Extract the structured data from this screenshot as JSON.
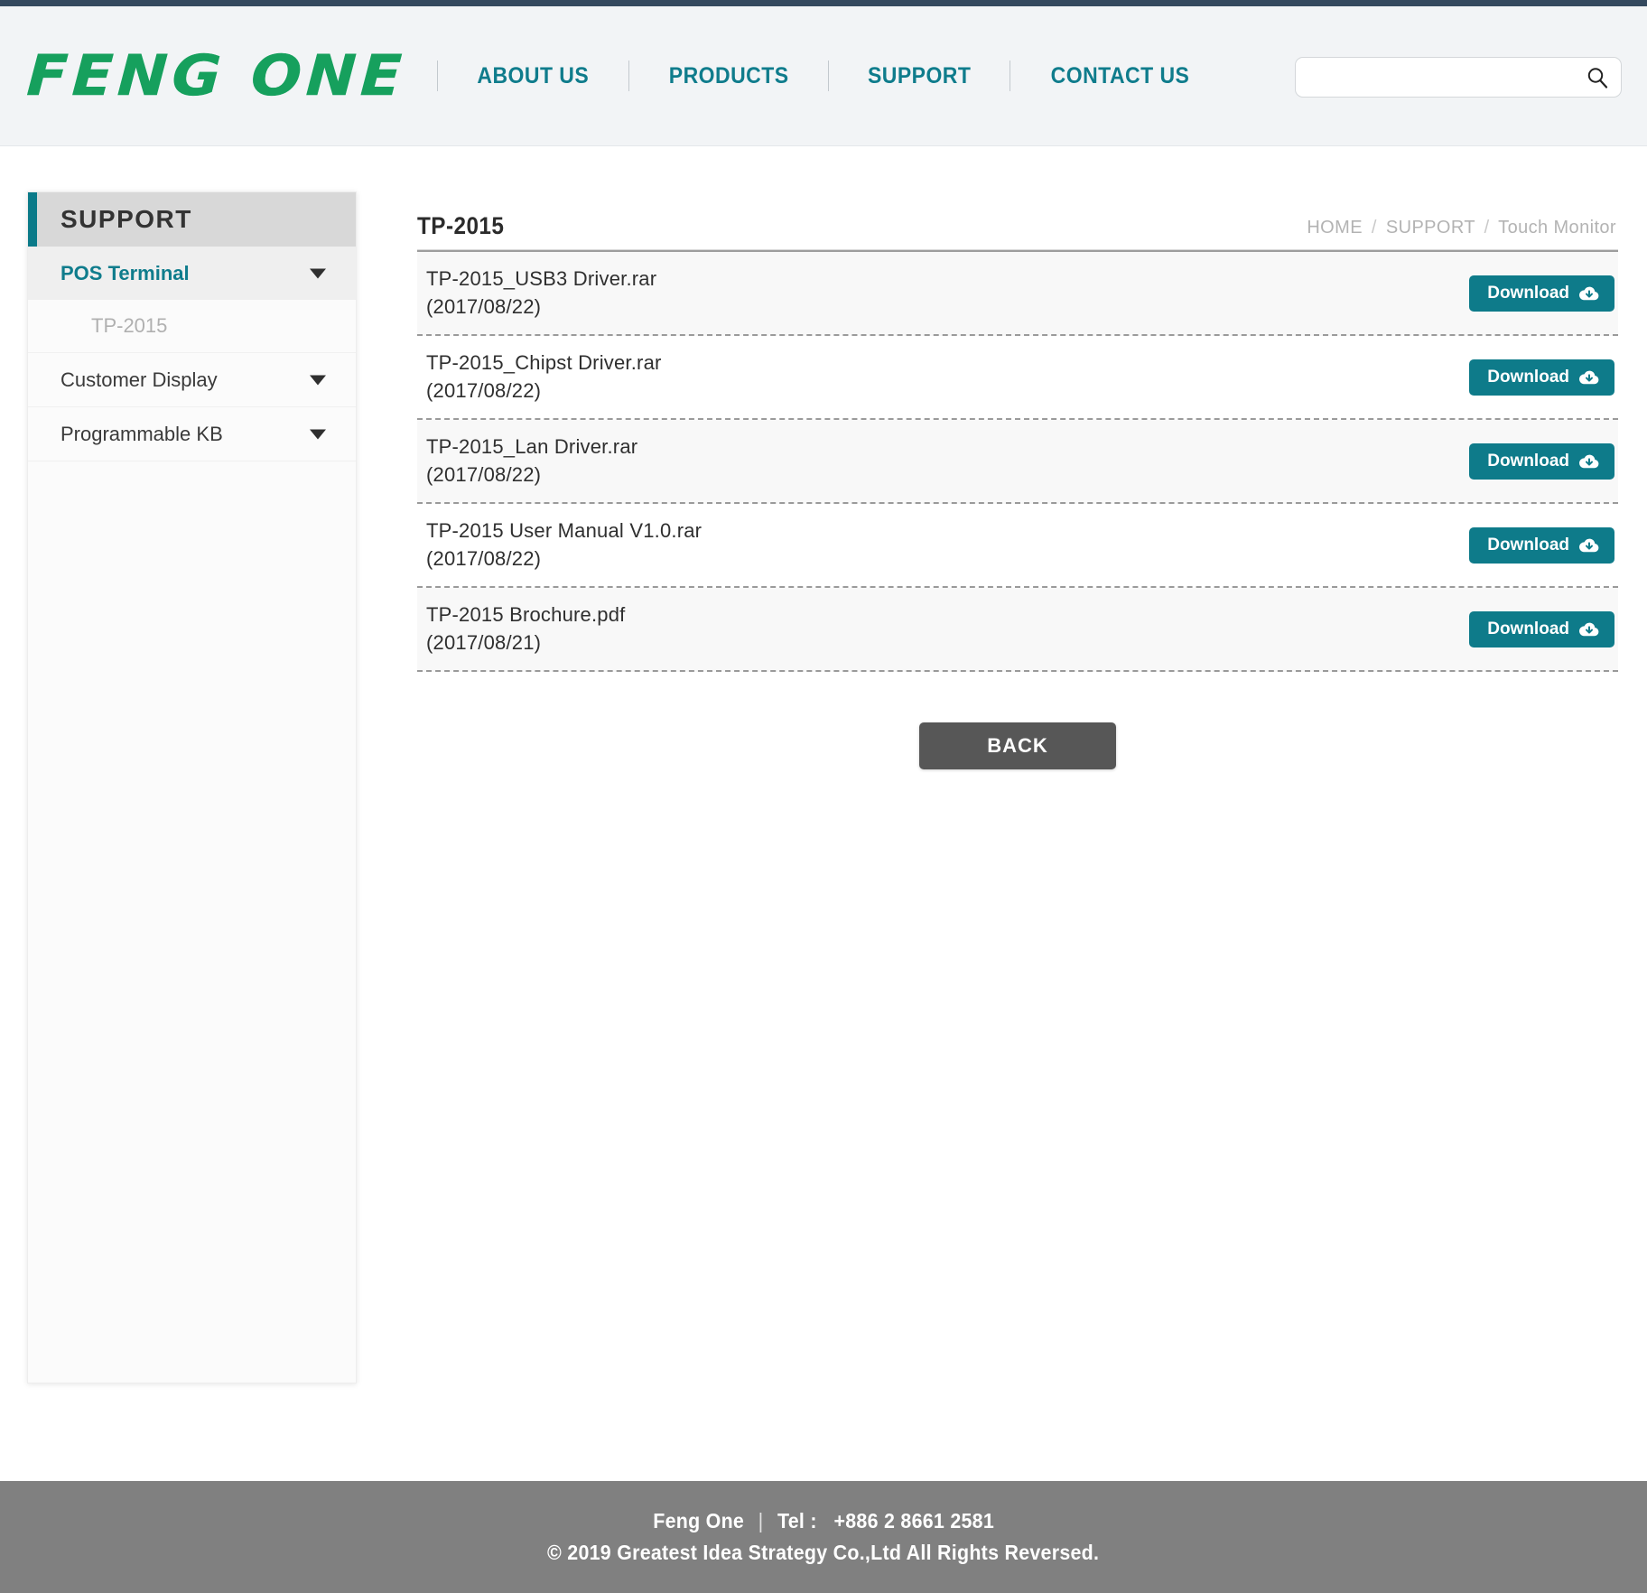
{
  "header": {
    "logo_text": "FENG ONE",
    "nav": [
      {
        "label": "ABOUT US"
      },
      {
        "label": "PRODUCTS"
      },
      {
        "label": "SUPPORT"
      },
      {
        "label": "CONTACT US"
      }
    ],
    "search": {
      "value": "",
      "placeholder": "",
      "icon": "search-icon"
    }
  },
  "sidebar": {
    "title": "SUPPORT",
    "items": [
      {
        "label": "POS Terminal",
        "active": true,
        "caret": "chevron-down-icon"
      },
      {
        "label": "Customer Display",
        "active": false,
        "caret": "chevron-down-icon"
      },
      {
        "label": "Programmable KB",
        "active": false,
        "caret": "chevron-down-icon"
      }
    ],
    "sub_items": [
      {
        "label": "TP-2015",
        "parent": "POS Terminal"
      }
    ]
  },
  "main": {
    "page_title": "TP-2015",
    "breadcrumb": [
      {
        "label": "HOME",
        "current": false
      },
      {
        "label": "SUPPORT",
        "current": false
      },
      {
        "label": "Touch Monitor",
        "current": true
      }
    ],
    "breadcrumb_separator": "/",
    "download_label": "Download",
    "download_icon": "cloud-download-icon",
    "files": [
      {
        "name": "TP-2015_USB3 Driver.rar",
        "date": "(2017/08/22)"
      },
      {
        "name": "TP-2015_Chipst Driver.rar",
        "date": "(2017/08/22)"
      },
      {
        "name": "TP-2015_Lan Driver.rar",
        "date": "(2017/08/22)"
      },
      {
        "name": "TP-2015 User Manual V1.0.rar",
        "date": "(2017/08/22)"
      },
      {
        "name": "TP-2015 Brochure.pdf",
        "date": "(2017/08/21)"
      }
    ],
    "back_label": "BACK"
  },
  "footer": {
    "company": "Feng One",
    "tel_label": "Tel :",
    "tel_number": "+886 2 8661 2581",
    "copyright": "© 2019 Greatest Idea Strategy Co.,Ltd All Rights Reversed."
  },
  "colors": {
    "accent_teal": "#0e7b8a",
    "logo_green": "#16a05d",
    "topstrip_navy": "#34495e",
    "footer_gray": "#808080",
    "back_gray": "#575757"
  }
}
